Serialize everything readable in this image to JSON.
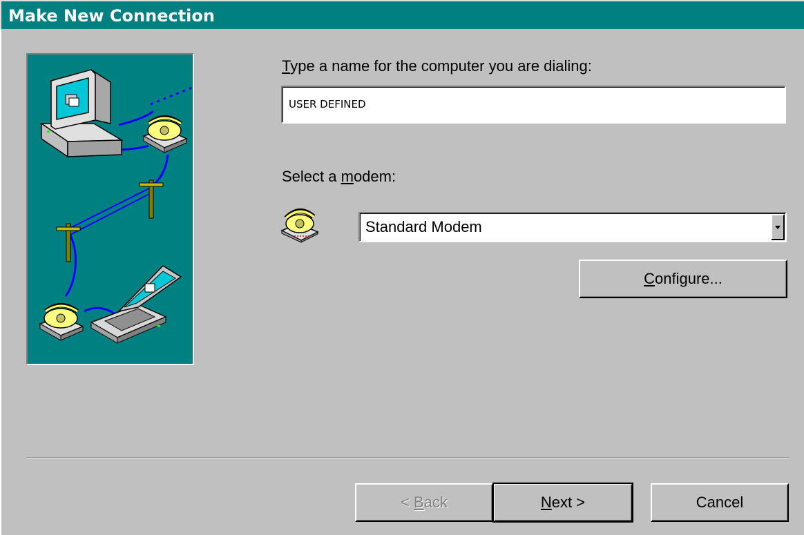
{
  "window": {
    "title": "Make New Connection"
  },
  "name_field": {
    "label_mnemonic": "T",
    "label_rest": "ype a name for the computer you are dialing:",
    "value": "USER DEFINED"
  },
  "modem": {
    "label_prefix": "Select a ",
    "label_mnemonic": "m",
    "label_rest": "odem:",
    "selected": "Standard Modem",
    "icon": "telephone-modem-icon"
  },
  "buttons": {
    "configure": {
      "mnemonic": "C",
      "rest": "onfigure..."
    },
    "back": {
      "prefix": "< ",
      "mnemonic": "B",
      "rest": "ack"
    },
    "next": {
      "mnemonic": "N",
      "rest": "ext >"
    },
    "cancel": "Cancel"
  },
  "colors": {
    "title_bar": "#008080",
    "face": "#c0c0c0",
    "illustration_bg": "#008080"
  },
  "illustration": {
    "icon": "dial-up-network-illustration"
  }
}
